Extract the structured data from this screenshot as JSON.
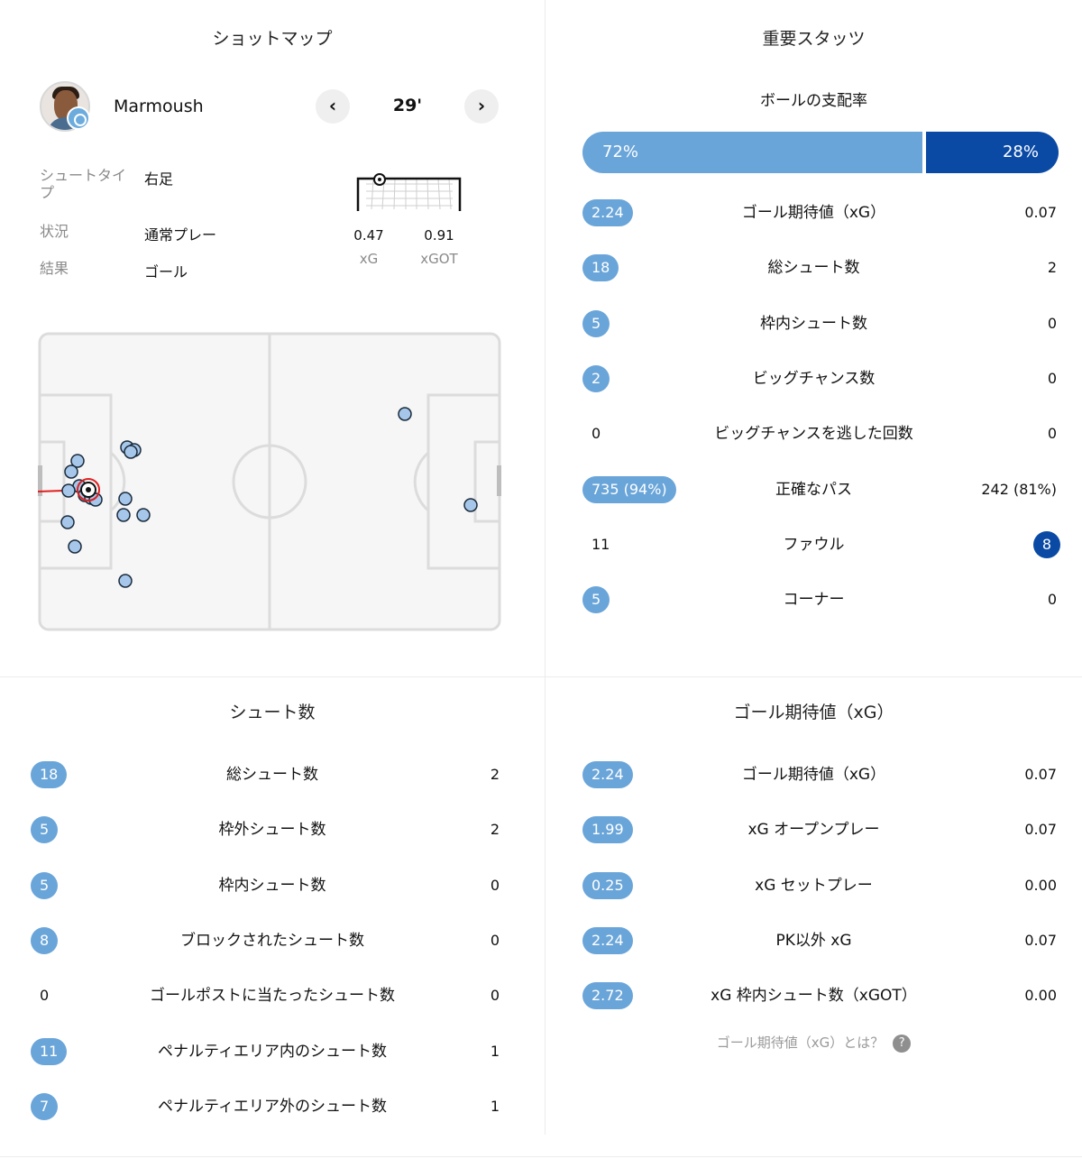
{
  "shotmap": {
    "title": "ショットマップ",
    "player": "Marmoush",
    "minute": "29'",
    "prev_label": "‹",
    "next_label": "›",
    "info": [
      {
        "label": "シュートタイプ",
        "value": "右足"
      },
      {
        "label": "状況",
        "value": "通常プレー"
      },
      {
        "label": "結果",
        "value": "ゴール"
      }
    ],
    "xg": {
      "value": "0.47",
      "label": "xG"
    },
    "xgot": {
      "value": "0.91",
      "label": "xGOT"
    },
    "colors": {
      "shot_fill": "#a7c7ea",
      "goal_ring": "#e02020",
      "line": "#d8d8d8"
    }
  },
  "key_stats": {
    "title": "重要スタッツ",
    "possession": {
      "label": "ボールの支配率",
      "home": "72%",
      "away": "28%",
      "home_share": 0.72
    },
    "rows": [
      {
        "left": "2.24",
        "label": "ゴール期待値（xG）",
        "right": "0.07",
        "left_pill": true,
        "right_pill": false
      },
      {
        "left": "18",
        "label": "総シュート数",
        "right": "2",
        "left_pill": true,
        "right_pill": false
      },
      {
        "left": "5",
        "label": "枠内シュート数",
        "right": "0",
        "left_pill": true,
        "right_pill": false
      },
      {
        "left": "2",
        "label": "ビッグチャンス数",
        "right": "0",
        "left_pill": true,
        "right_pill": false
      },
      {
        "left": "0",
        "label": "ビッグチャンスを逃した回数",
        "right": "0",
        "left_pill": false,
        "right_pill": false
      },
      {
        "left": "735 (94%)",
        "label": "正確なパス",
        "right": "242 (81%)",
        "left_pill": true,
        "right_pill": false
      },
      {
        "left": "11",
        "label": "ファウル",
        "right": "8",
        "left_pill": false,
        "right_pill": true
      },
      {
        "left": "5",
        "label": "コーナー",
        "right": "0",
        "left_pill": true,
        "right_pill": false
      }
    ]
  },
  "shots": {
    "title": "シュート数",
    "rows": [
      {
        "left": "18",
        "label": "総シュート数",
        "right": "2",
        "left_pill": true
      },
      {
        "left": "5",
        "label": "枠外シュート数",
        "right": "2",
        "left_pill": true
      },
      {
        "left": "5",
        "label": "枠内シュート数",
        "right": "0",
        "left_pill": true
      },
      {
        "left": "8",
        "label": "ブロックされたシュート数",
        "right": "0",
        "left_pill": true
      },
      {
        "left": "0",
        "label": "ゴールポストに当たったシュート数",
        "right": "0",
        "left_pill": false
      },
      {
        "left": "11",
        "label": "ペナルティエリア内のシュート数",
        "right": "1",
        "left_pill": true
      },
      {
        "left": "7",
        "label": "ペナルティエリア外のシュート数",
        "right": "1",
        "left_pill": true
      }
    ]
  },
  "xg": {
    "title": "ゴール期待値（xG）",
    "rows": [
      {
        "left": "2.24",
        "label": "ゴール期待値（xG）",
        "right": "0.07",
        "left_pill": true
      },
      {
        "left": "1.99",
        "label": "xG オープンプレー",
        "right": "0.07",
        "left_pill": true
      },
      {
        "left": "0.25",
        "label": "xG セットプレー",
        "right": "0.00",
        "left_pill": true
      },
      {
        "left": "2.24",
        "label": "PK以外 xG",
        "right": "0.07",
        "left_pill": true
      },
      {
        "left": "2.72",
        "label": "xG 枠内シュート数（xGOT）",
        "right": "0.00",
        "left_pill": true
      }
    ],
    "help_text": "ゴール期待値（xG）とは？",
    "help_icon": "?"
  },
  "colors": {
    "home": "#6aa5d9",
    "away": "#0a4aa5"
  }
}
